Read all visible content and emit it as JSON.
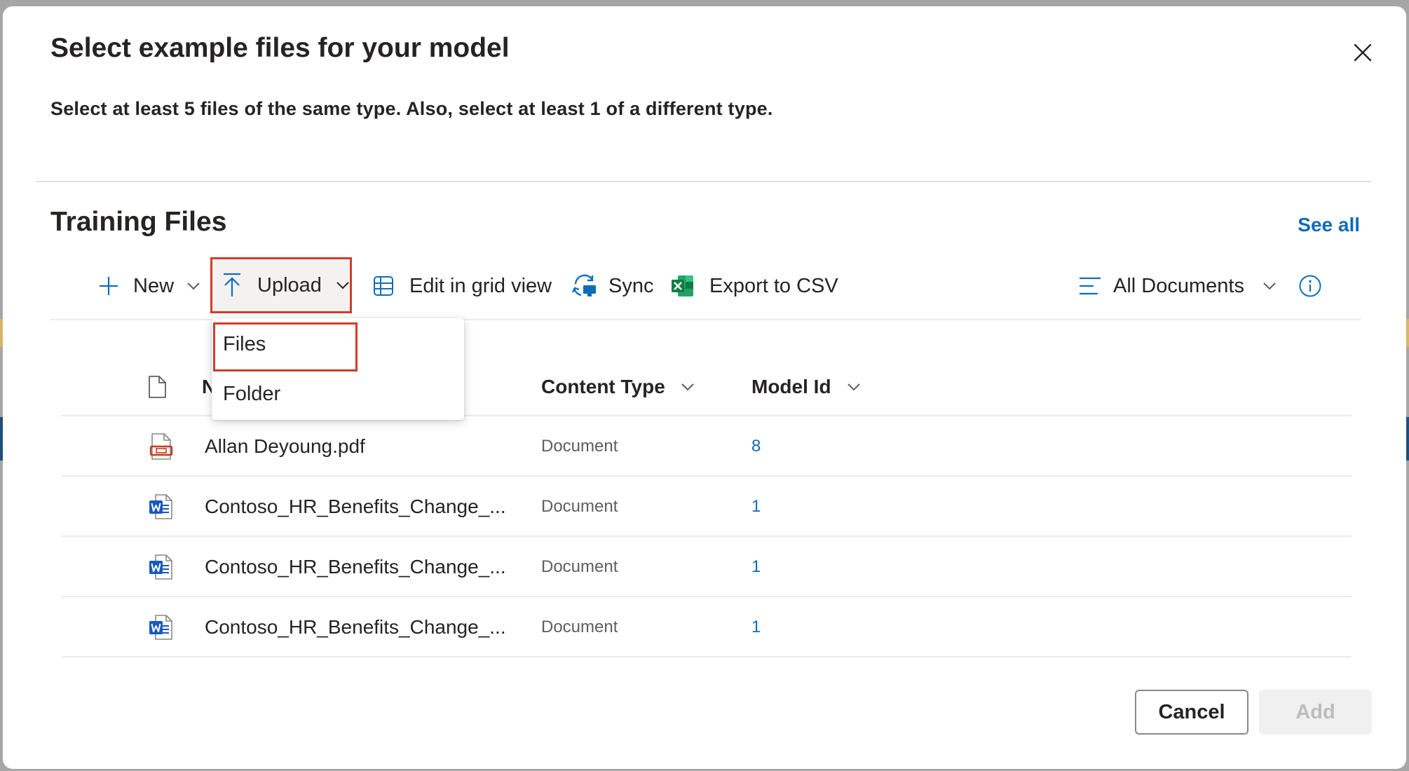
{
  "dialog": {
    "title": "Select example files for your model",
    "subtitle": "Select at least 5 files of the same type. Also, select at least 1 of a different type.",
    "close_icon": "close-icon"
  },
  "section": {
    "title": "Training Files",
    "see_all": "See all"
  },
  "commandbar": {
    "new_label": "New",
    "upload_label": "Upload",
    "grid_label": "Edit in grid view",
    "sync_label": "Sync",
    "csv_label": "Export to CSV",
    "view_label": "All Documents",
    "icons": [
      "plus-icon",
      "upload-icon",
      "grid-icon",
      "sync-icon",
      "excel-icon",
      "view-lines-icon",
      "info-icon"
    ]
  },
  "upload_menu": {
    "items": [
      {
        "label": "Files",
        "highlighted": true
      },
      {
        "label": "Folder",
        "highlighted": false
      }
    ]
  },
  "table": {
    "columns": {
      "name": "N",
      "content_type": "Content Type",
      "model_id": "Model Id"
    },
    "rows": [
      {
        "name": "Allan Deyoung.pdf",
        "content_type": "Document",
        "model_id": "8",
        "icon": "pdf-file-icon"
      },
      {
        "name": "Contoso_HR_Benefits_Change_...",
        "content_type": "Document",
        "model_id": "1",
        "icon": "word-file-icon"
      },
      {
        "name": "Contoso_HR_Benefits_Change_...",
        "content_type": "Document",
        "model_id": "1",
        "icon": "word-file-icon"
      },
      {
        "name": "Contoso_HR_Benefits_Change_...",
        "content_type": "Document",
        "model_id": "1",
        "icon": "word-file-icon"
      }
    ]
  },
  "footer": {
    "cancel_label": "Cancel",
    "add_label": "Add",
    "add_disabled": true
  },
  "colors": {
    "accent": "#0f6cbd",
    "highlight": "#d13c2b",
    "pdf": "#c43e1c",
    "word": "#185abd",
    "excel": "#107c41"
  }
}
